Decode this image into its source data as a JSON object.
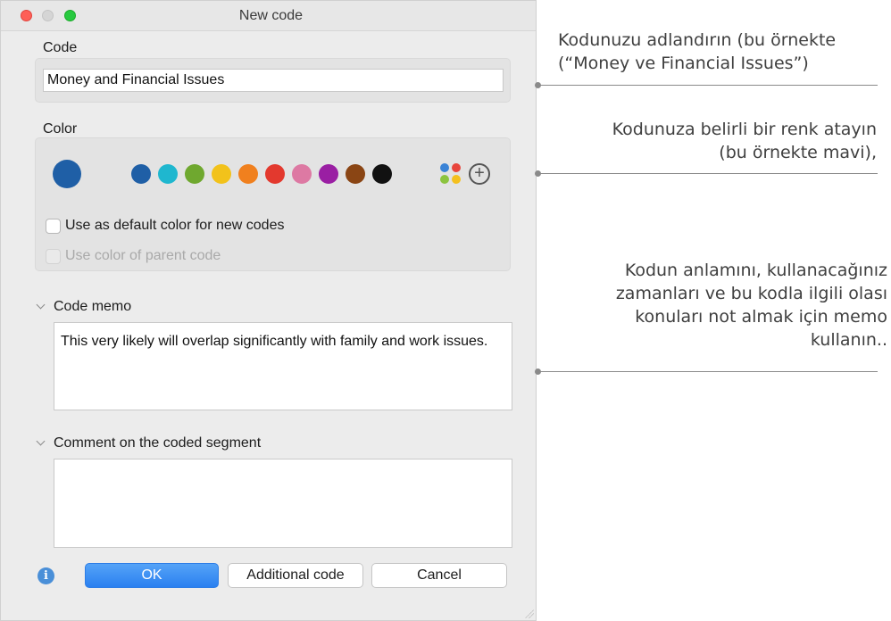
{
  "window": {
    "title": "New code"
  },
  "code_section": {
    "label": "Code",
    "value": "Money and Financial Issues"
  },
  "color_section": {
    "label": "Color",
    "selected_color": "#1f5fa6",
    "swatches": [
      "#1f5fa6",
      "#1fb7cf",
      "#6fa82f",
      "#f2c21b",
      "#f0801e",
      "#e3392e",
      "#dd79a3",
      "#9a1fa3",
      "#8a4514",
      "#111111"
    ],
    "palette_icon": "palette-icon",
    "add_color_icon": "add-circle-icon",
    "default_checkbox_label": "Use as default color for new codes",
    "parent_checkbox_label": "Use color of parent code"
  },
  "code_memo": {
    "label": "Code memo",
    "text": "This very likely will overlap significantly with family and work issues."
  },
  "comment": {
    "label": "Comment on the coded segment",
    "text": ""
  },
  "buttons": {
    "ok": "OK",
    "additional": "Additional code",
    "cancel": "Cancel"
  },
  "annotations": {
    "a1": {
      "line1": "Kodunuzu adlandırın (bu örnekte",
      "line2": "(“Money ve Financial Issues”)"
    },
    "a2": {
      "line1": "Kodunuza belirli bir renk atayın",
      "line2": "(bu örnekte mavi),"
    },
    "a3": {
      "line1": "Kodun anlamını, kullanacağınız",
      "line2": "zamanları ve bu kodla ilgili olası",
      "line3": "konuları not almak için memo",
      "line4": "kullanın.."
    }
  }
}
